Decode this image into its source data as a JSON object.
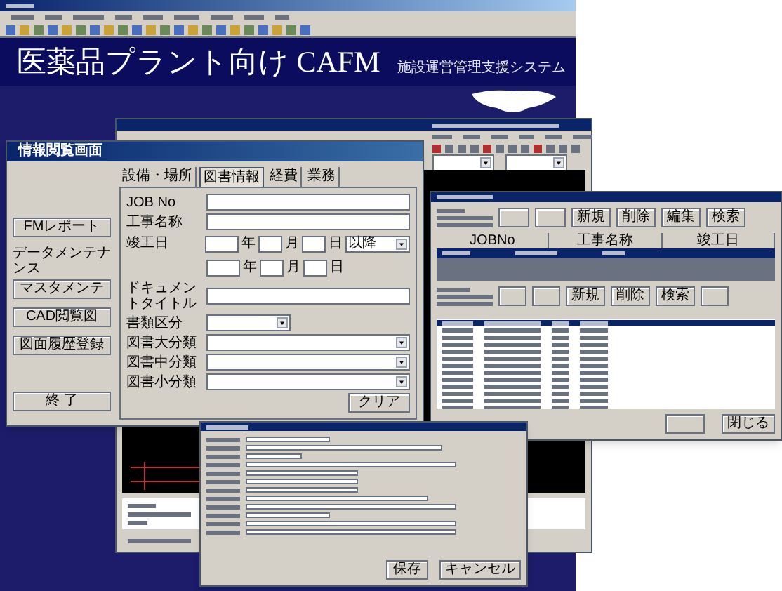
{
  "banner": {
    "title": "医薬品プラント向け CAFM",
    "subtitle": "施設運営管理支援システム"
  },
  "info_window": {
    "title": "情報閲覧画面",
    "tabs": [
      {
        "label": "設備・場所",
        "selected": false
      },
      {
        "label": "図書情報",
        "selected": true
      },
      {
        "label": "経費",
        "selected": false
      },
      {
        "label": "業務",
        "selected": false
      }
    ],
    "side_buttons": [
      {
        "kind": "button",
        "label": "FMレポート"
      },
      {
        "kind": "label",
        "label": "データメンテナンス"
      },
      {
        "kind": "button",
        "label": "マスタメンテ"
      },
      {
        "kind": "button",
        "label": "CAD閲覧図"
      },
      {
        "kind": "button",
        "label": "図面履歴登録"
      }
    ],
    "exit_button": "終 了",
    "fields": [
      {
        "kind": "text",
        "label": "JOB No"
      },
      {
        "kind": "text",
        "label": "工事名称"
      },
      {
        "kind": "date",
        "label": "竣工日",
        "year": "年",
        "month": "月",
        "day": "日",
        "option": "以降"
      },
      {
        "kind": "date",
        "year": "年",
        "month": "月",
        "day": "日"
      },
      {
        "kind": "text",
        "label": "ドキュメントタイトル"
      },
      {
        "kind": "short_select",
        "label": "書類区分"
      },
      {
        "kind": "select",
        "label": "図書大分類"
      },
      {
        "kind": "select",
        "label": "図書中分類"
      },
      {
        "kind": "select",
        "label": "図書小分類"
      }
    ],
    "clear_button": "クリア"
  },
  "list_window": {
    "top_buttons": [
      "新規",
      "削除",
      "編集",
      "検索"
    ],
    "columns": [
      "JOBNo",
      "工事名称",
      "竣工日"
    ],
    "bottom_buttons": [
      "新規",
      "削除",
      "検索"
    ],
    "close_button": "閉じる"
  },
  "detail_window": {
    "save_button": "保存",
    "cancel_button": "キャンセル"
  }
}
